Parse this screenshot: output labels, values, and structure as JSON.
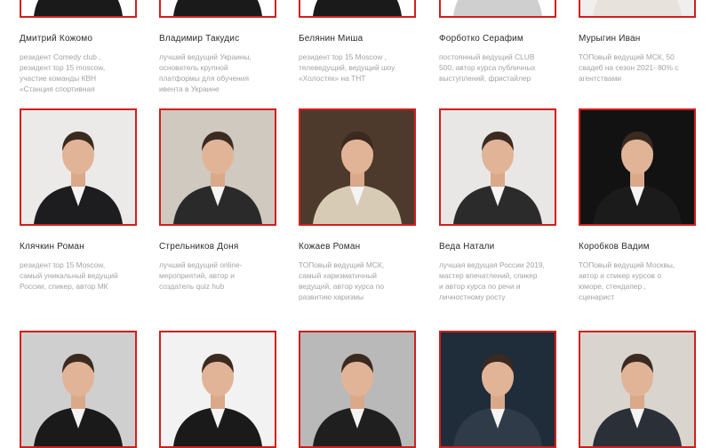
{
  "colors": {
    "accent": "#d21e1e",
    "name": "#2b2b2b",
    "desc": "#a3a3a3"
  },
  "rows": [
    {
      "people": [
        {
          "name": "Дмитрий Кожомо",
          "desc": [
            "резидент Comedy club ,",
            "резидент top 15 moscow,",
            "участие команды КВН",
            "«Станция спортивная"
          ],
          "bg": "#ffffff",
          "suit": "#1a1a1a"
        },
        {
          "name": "Владимир Такудис",
          "desc": [
            "лучший ведущий Украины,",
            "основатель крупной",
            "платформы для обучения",
            "ивента в Украине"
          ],
          "bg": "#ffffff",
          "suit": "#1a1a1a"
        },
        {
          "name": "Белянин Миша",
          "desc": [
            "резидент top 15 Moscow ,",
            "телеведущий, ведущий шоу",
            "«Холостяк» на ТНТ"
          ],
          "bg": "#ffffff",
          "suit": "#1a1a1a"
        },
        {
          "name": "Форботко Серафим",
          "desc": [
            "постоянный ведущий CLUB",
            "500, автор курса публичных",
            "выступлений, фристайлер"
          ],
          "bg": "#ffffff",
          "suit": "#cfcfcf"
        },
        {
          "name": "Мурыгин Иван",
          "desc": [
            "ТОПовый ведущий МСК, 50",
            "свадеб на сезон 2021- 80% с",
            "агентствами"
          ],
          "bg": "#f1efee",
          "suit": "#e8e2dc"
        }
      ]
    },
    {
      "people": [
        {
          "name": "Клячкин Роман",
          "desc": [
            "резидент top 15 Moscow,",
            "самый уникальный ведущий",
            "России, спикер, автор МК"
          ],
          "bg": "#eceae8",
          "suit": "#1d1d1f"
        },
        {
          "name": "Стрельников Доня",
          "desc": [
            "лучший ведущий online-",
            "мероприятий, автор и",
            "создатель quiz hub"
          ],
          "bg": "#cfc9c0",
          "suit": "#2a2a2a"
        },
        {
          "name": "Кожаев Роман",
          "desc": [
            "ТОПовый ведущий МСК,",
            "самый харизматичный",
            "ведущий, автор курса по",
            "развитию харизмы"
          ],
          "bg": "#4d3a2c",
          "suit": "#d8cbb5"
        },
        {
          "name": "Веда Натали",
          "desc": [
            "лучшая ведущая России 2019,",
            "мастер впечатлений, спикер",
            "и автор курса по речи и",
            "личностному росту"
          ],
          "bg": "#e9e7e5",
          "suit": "#2b2b2b"
        },
        {
          "name": "Коробков Вадим",
          "desc": [
            "ТОПовый ведущий Москвы,",
            "автор и спикер курсов о",
            "юморе, стендапер ,",
            "сценарист"
          ],
          "bg": "#121212",
          "suit": "#1b1b1b"
        }
      ]
    },
    {
      "people": [
        {
          "name": "",
          "desc": [],
          "bg": "#cfcfcf",
          "suit": "#1a1a1a"
        },
        {
          "name": "",
          "desc": [],
          "bg": "#f2f2f2",
          "suit": "#1a1a1a"
        },
        {
          "name": "",
          "desc": [],
          "bg": "#b9b9b9",
          "suit": "#1f1f1f"
        },
        {
          "name": "",
          "desc": [],
          "bg": "#1f2c3a",
          "suit": "#2f3b48"
        },
        {
          "name": "",
          "desc": [],
          "bg": "#d9d4cd",
          "suit": "#2b2f38"
        }
      ]
    }
  ]
}
